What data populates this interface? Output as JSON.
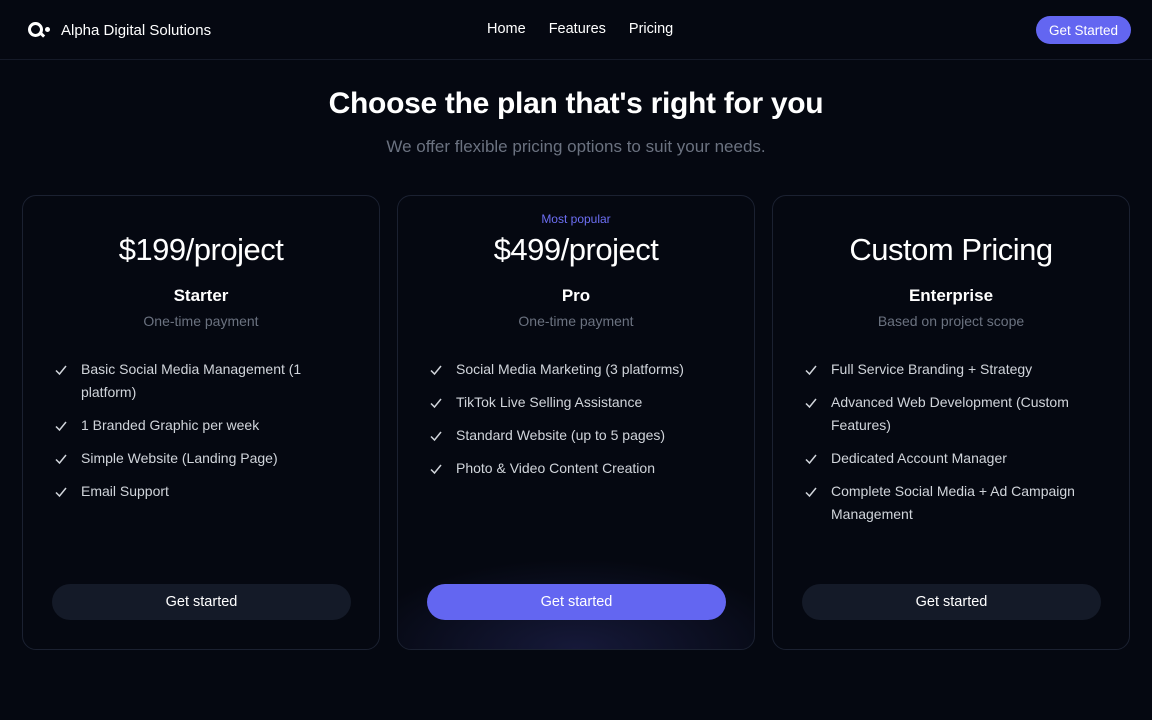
{
  "colors": {
    "background": "#050811",
    "accent": "#6366f1",
    "muted_text": "#6b7280",
    "feature_text": "#d1d5db",
    "card_border": "#1b2131",
    "secondary_button": "#141a28"
  },
  "nav": {
    "logo_icon": "search-dot-logo-icon",
    "brand": "Alpha Digital Solutions",
    "links": [
      "Home",
      "Features",
      "Pricing"
    ],
    "cta": "Get Started"
  },
  "hero": {
    "title": "Choose the plan that's right for you",
    "subtitle": "We offer flexible pricing options to suit your needs."
  },
  "plans": [
    {
      "badge": "",
      "price": "$199/project",
      "name": "Starter",
      "note": "One-time payment",
      "features": [
        "Basic Social Media Management (1 platform)",
        "1 Branded Graphic per week",
        "Simple Website (Landing Page)",
        "Email Support"
      ],
      "button": "Get started",
      "highlighted": false
    },
    {
      "badge": "Most popular",
      "price": "$499/project",
      "name": "Pro",
      "note": "One-time payment",
      "features": [
        "Social Media Marketing (3 platforms)",
        "TikTok Live Selling Assistance",
        "Standard Website (up to 5 pages)",
        "Photo & Video Content Creation"
      ],
      "button": "Get started",
      "highlighted": true
    },
    {
      "badge": "",
      "price": "Custom Pricing",
      "name": "Enterprise",
      "note": "Based on project scope",
      "features": [
        "Full Service Branding + Strategy",
        "Advanced Web Development (Custom Features)",
        "Dedicated Account Manager",
        "Complete Social Media + Ad Campaign Management"
      ],
      "button": "Get started",
      "highlighted": false
    }
  ]
}
